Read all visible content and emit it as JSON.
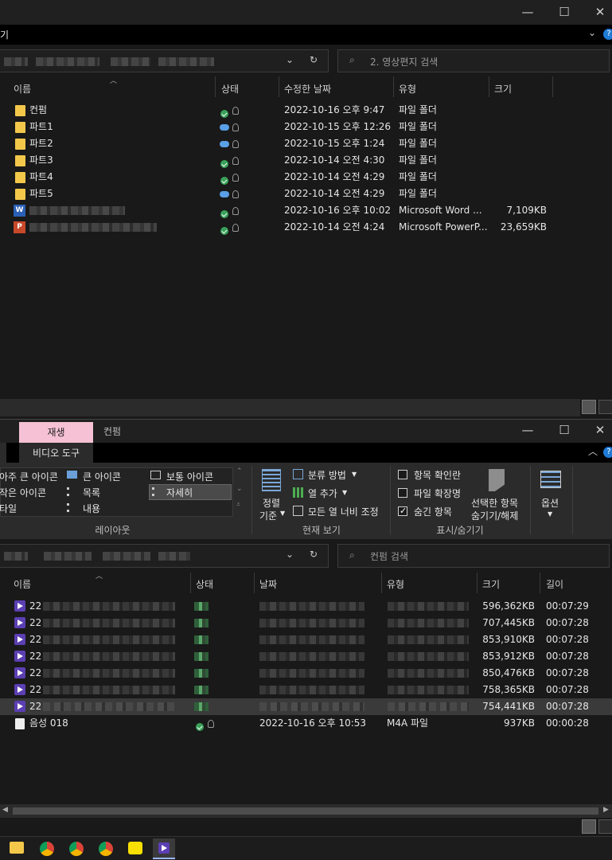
{
  "window1": {
    "win_min": "—",
    "win_max": "☐",
    "win_close": "✕",
    "ribbon_edge_text": "기",
    "search_placeholder": "2. 영상편지 검색",
    "columns": [
      "이름",
      "상태",
      "수정한 날짜",
      "유형",
      "크기"
    ],
    "rows": [
      {
        "name": "컨펌",
        "icon": "folder",
        "status": "ok",
        "date": "2022-10-16 오후 9:47",
        "type": "파일 폴더",
        "size": ""
      },
      {
        "name": "파트1",
        "icon": "folder",
        "status": "cloud",
        "date": "2022-10-15 오후 12:26",
        "type": "파일 폴더",
        "size": ""
      },
      {
        "name": "파트2",
        "icon": "folder",
        "status": "cloud",
        "date": "2022-10-15 오후 1:24",
        "type": "파일 폴더",
        "size": ""
      },
      {
        "name": "파트3",
        "icon": "folder",
        "status": "ok",
        "date": "2022-10-14 오전 4:30",
        "type": "파일 폴더",
        "size": ""
      },
      {
        "name": "파트4",
        "icon": "folder",
        "status": "ok",
        "date": "2022-10-14 오전 4:29",
        "type": "파일 폴더",
        "size": ""
      },
      {
        "name": "파트5",
        "icon": "folder",
        "status": "cloud",
        "date": "2022-10-14 오전 4:29",
        "type": "파일 폴더",
        "size": ""
      },
      {
        "name": "",
        "icon": "word",
        "status": "ok",
        "date": "2022-10-16 오후 10:02",
        "type": "Microsoft Word ...",
        "size": "7,109KB"
      },
      {
        "name": "",
        "icon": "ppt",
        "status": "ok",
        "date": "2022-10-14 오전 4:24",
        "type": "Microsoft PowerP...",
        "size": "23,659KB"
      }
    ]
  },
  "window2": {
    "tab_play": "재생",
    "tab_confirm": "컨펌",
    "tab_video_tools": "비디오 도구",
    "win_min": "—",
    "win_max": "☐",
    "win_close": "✕",
    "layout": {
      "extra_large": "아주 큰 아이콘",
      "large": "큰 아이콘",
      "medium": "보통 아이콘",
      "small": "작은 아이콘",
      "list": "목록",
      "details": "자세히",
      "tiles": "타일",
      "content": "내용",
      "group_label": "레이아웃"
    },
    "current_view": {
      "sort_by_line1": "정렬",
      "sort_by_line2": "기준",
      "group_by": "분류 방법",
      "add_columns": "열 추가",
      "size_all_columns": "모든 열 너비 조정",
      "group_label": "현재 보기"
    },
    "show_hide": {
      "item_checkboxes": "항목 확인란",
      "file_extensions": "파일 확장명",
      "hidden_items": "숨긴 항목",
      "hide_selected_line1": "선택한 항목",
      "hide_selected_line2": "숨기기/해제",
      "group_label": "표시/숨기기"
    },
    "options": "옵션",
    "search_placeholder": "컨펌 검색",
    "columns": [
      "이름",
      "상태",
      "날짜",
      "유형",
      "크기",
      "길이"
    ],
    "rows": [
      {
        "name_prefix": "22",
        "size": "596,362KB",
        "length": "00:07:29"
      },
      {
        "name_prefix": "22",
        "size": "707,445KB",
        "length": "00:07:28"
      },
      {
        "name_prefix": "22",
        "size": "853,910KB",
        "length": "00:07:28"
      },
      {
        "name_prefix": "22",
        "size": "853,912KB",
        "length": "00:07:28"
      },
      {
        "name_prefix": "22",
        "size": "850,476KB",
        "length": "00:07:28"
      },
      {
        "name_prefix": "22",
        "size": "758,365KB",
        "length": "00:07:28"
      },
      {
        "name_prefix": "22",
        "size": "754,441KB",
        "length": "00:07:28"
      }
    ],
    "audio_row": {
      "name": "음성 018",
      "date": "2022-10-16 오후 10:53",
      "type": "M4A 파일",
      "size": "937KB",
      "length": "00:00:28"
    }
  }
}
